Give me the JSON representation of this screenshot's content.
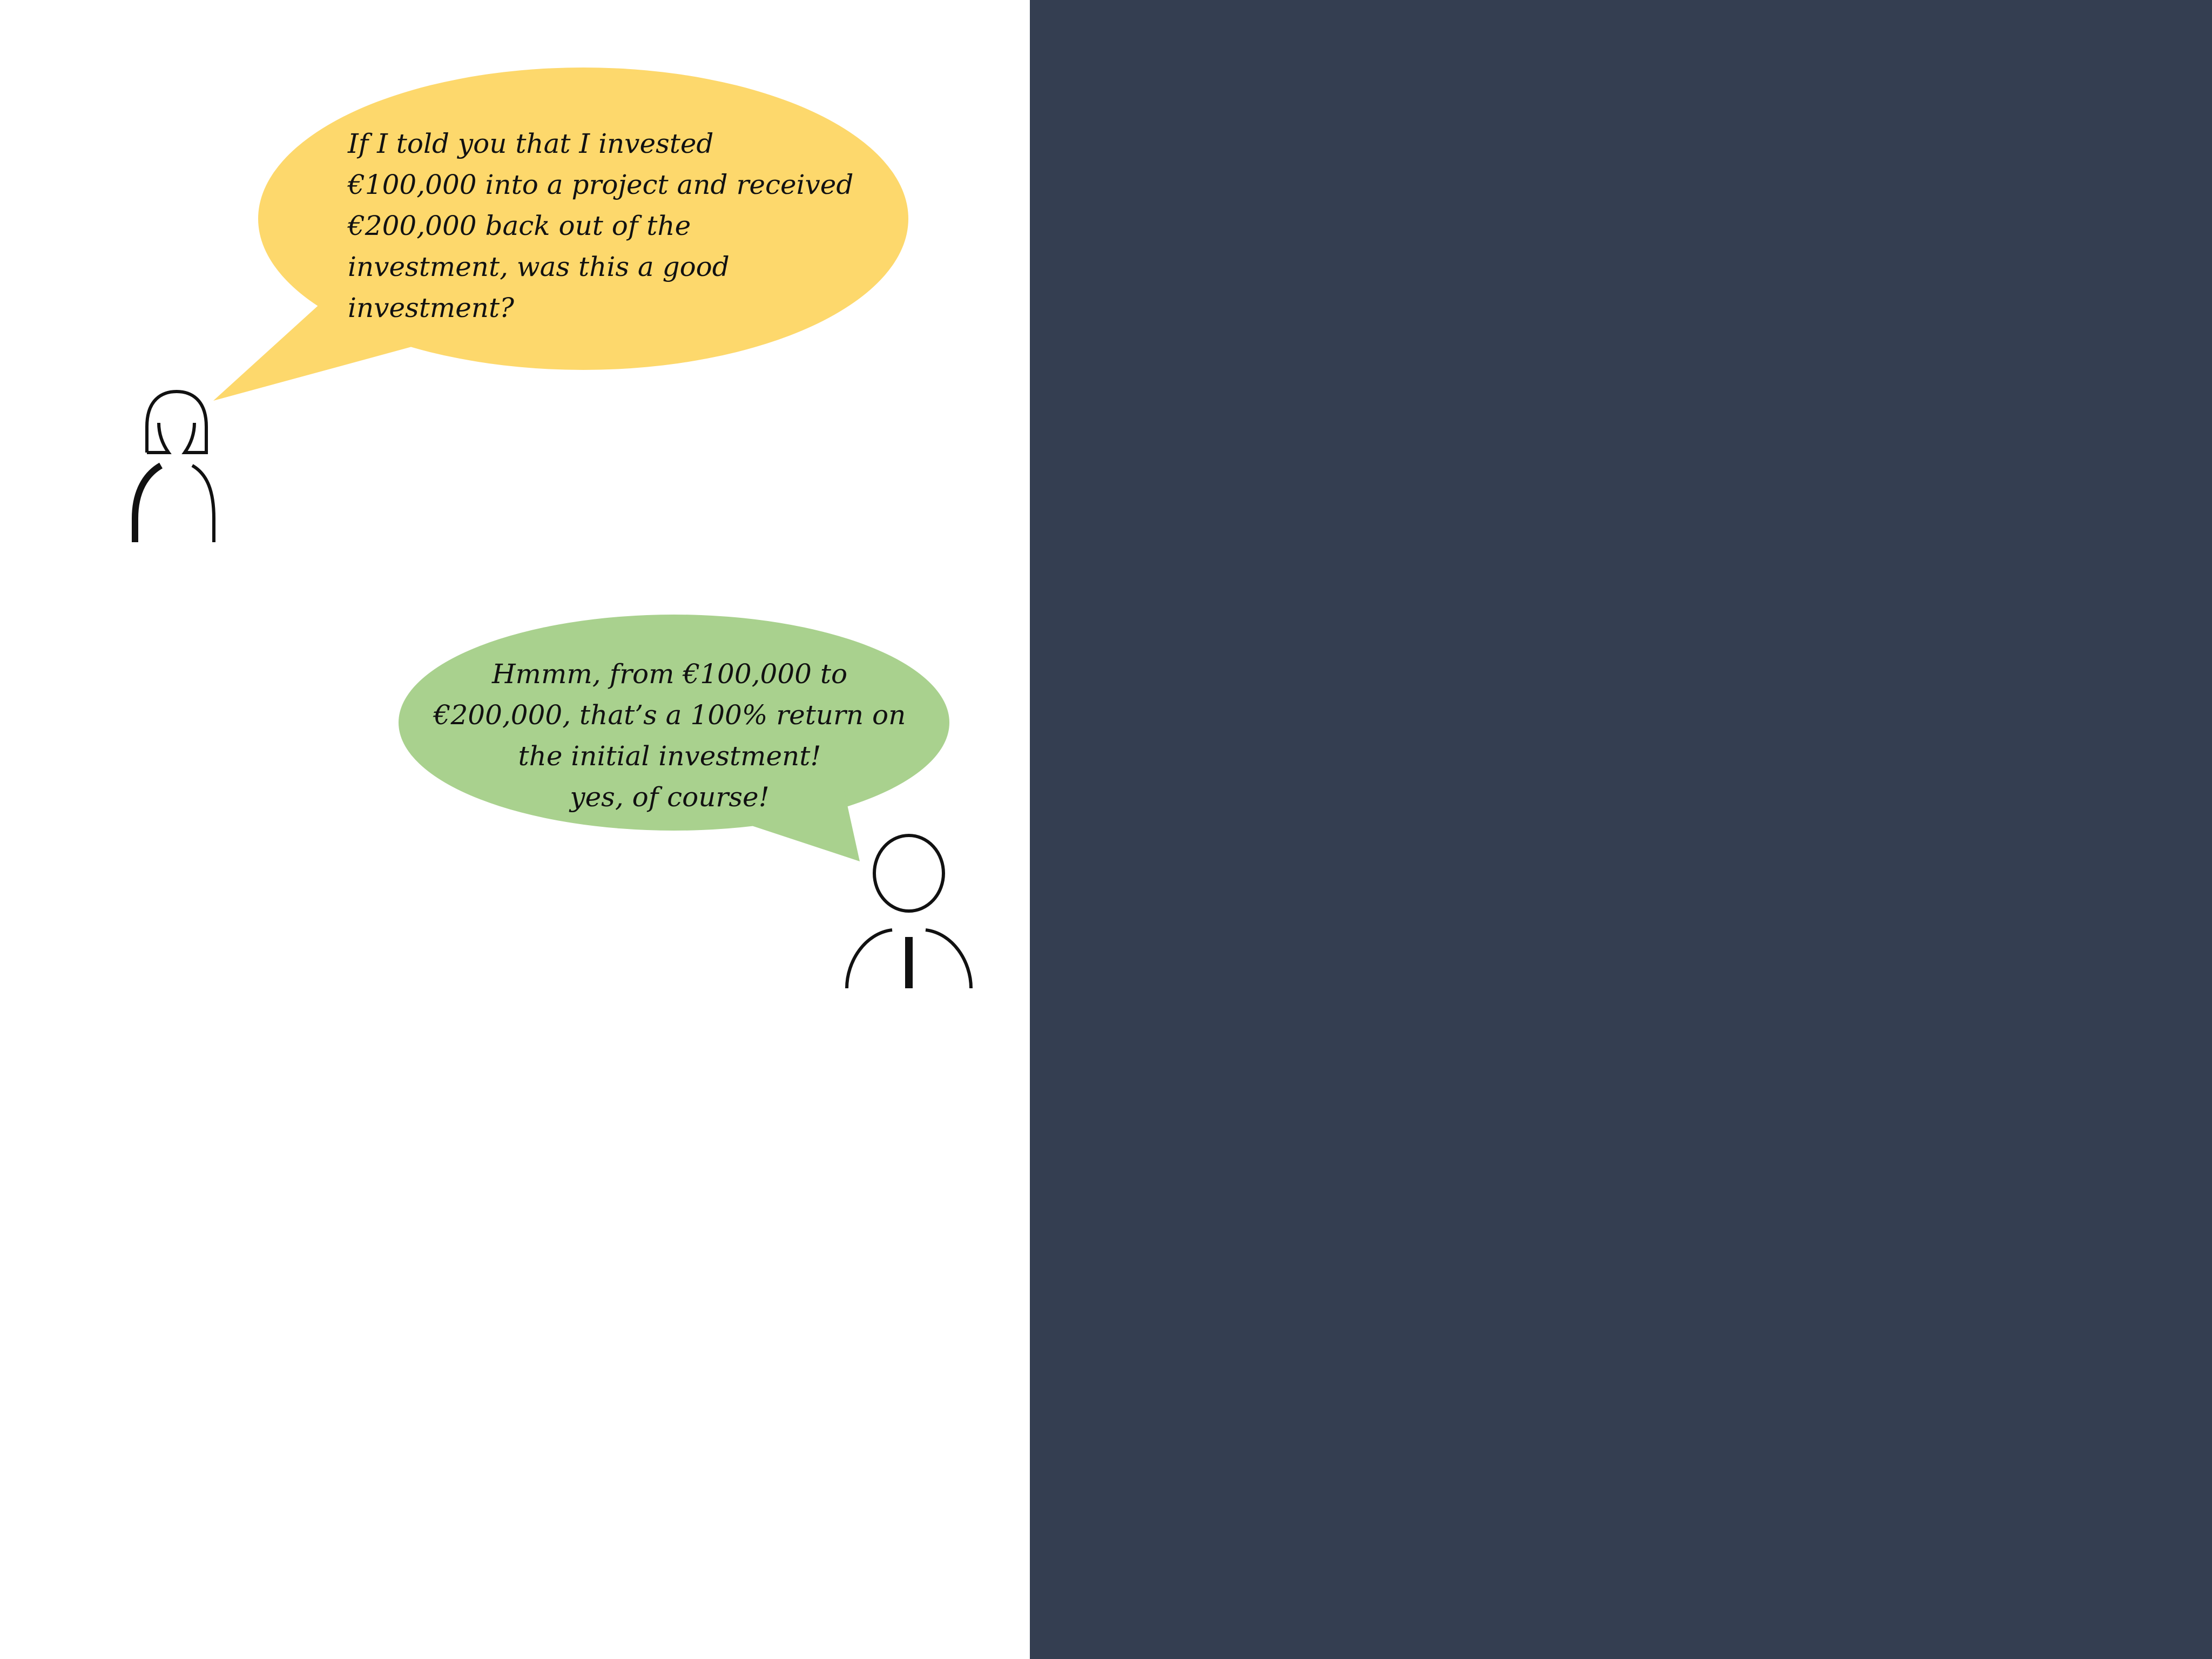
{
  "colors": {
    "background_left": "#ffffff",
    "background_right": "#343e51",
    "bubble_woman": "#fdd86c",
    "bubble_man": "#a9d18e",
    "figure_stroke": "#111111"
  },
  "icons": {
    "woman": "woman-figure-icon",
    "man": "man-figure-icon"
  },
  "dialogue": {
    "woman": {
      "lines": [
        "If I told you that I invested",
        "€100,000 into a project and received",
        "€200,000 back out of the",
        "investment, was this a good",
        "investment?"
      ]
    },
    "man": {
      "lines": [
        "Hmmm, from €100,000 to",
        "€200,000, that’s a 100% return on",
        "the initial investment!",
        "yes, of course!"
      ]
    }
  }
}
